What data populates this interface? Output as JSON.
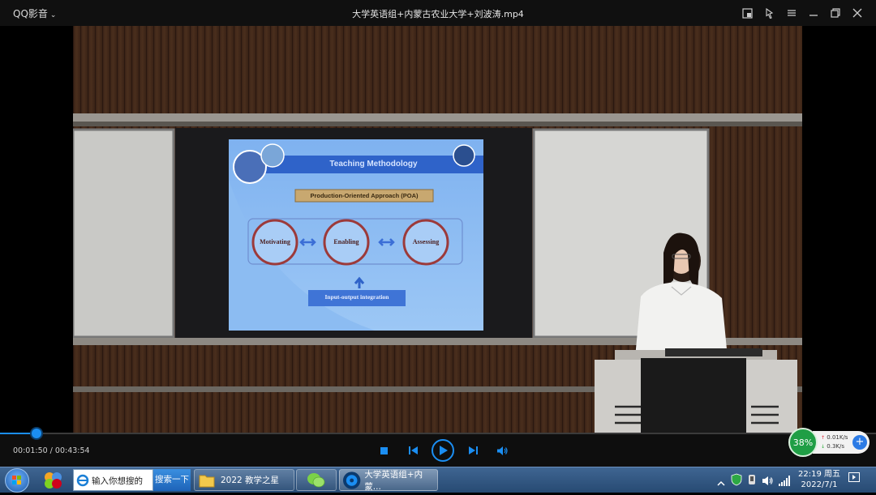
{
  "window": {
    "app_name": "QQ影音",
    "title": "大学英语组+内蒙古农业大学+刘波涛.mp4"
  },
  "slide": {
    "title": "Teaching Methodology",
    "approach": "Production-Oriented Approach (POA)",
    "stages": [
      "Motivating",
      "Enabling",
      "Assessing"
    ],
    "integration": "Input-output integration"
  },
  "player": {
    "current_time": "00:01:50",
    "total_time": "00:43:54",
    "time_display": "00:01:50 / 00:43:54",
    "progress": 0.042
  },
  "net_widget": {
    "percent": "38%",
    "upload": "0.01K/s",
    "download": "0.3K/s"
  },
  "taskbar": {
    "search_placeholder": "输入你想搜的",
    "search_button": "搜索一下",
    "folder_task": "2022 教学之星",
    "player_task": "大学英语组+内蒙...",
    "time": "22:19 周五",
    "date": "2022/7/1"
  },
  "colors": {
    "accent": "#1b8ef2",
    "titlebar_bg": "#101010",
    "taskbar_bg": "#2f5580",
    "net_green": "#1f9e45"
  }
}
